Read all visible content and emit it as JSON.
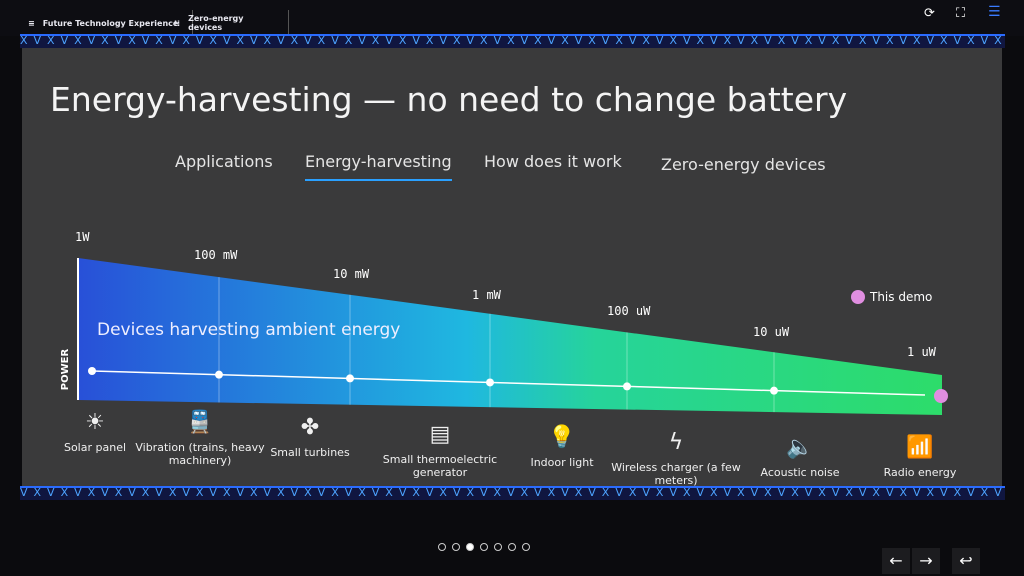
{
  "header": {
    "app_name": "Future Technology Experience",
    "section": "Zero-energy devices",
    "icons": [
      "logo-icon",
      "grid-icon",
      "refresh-icon",
      "fullscreen-icon",
      "menu-icon"
    ]
  },
  "slide": {
    "title": "Energy-harvesting — no need to change battery",
    "tabs": [
      {
        "label": "Applications"
      },
      {
        "label": "Energy-harvesting",
        "active": true
      },
      {
        "label": "How does it work"
      },
      {
        "label": "Zero-energy devices"
      }
    ],
    "chart": {
      "y_label": "POWER",
      "band_label": "Devices harvesting ambient energy",
      "power_levels": [
        "1W",
        "100 mW",
        "10 mW",
        "1 mW",
        "100 uW",
        "10 uW",
        "1 uW"
      ],
      "legend": "This demo",
      "legend_color": "#e08ee0",
      "gradient": [
        "#2850d8",
        "#1fb8e0",
        "#2ddc6a"
      ]
    },
    "sources": [
      {
        "label": "Solar panel",
        "icon": "solar-panel-icon"
      },
      {
        "label": "Vibration (trains, heavy machinery)",
        "icon": "train-icon"
      },
      {
        "label": "Small turbines",
        "icon": "turbine-icon"
      },
      {
        "label": "Small thermoelectric generator",
        "icon": "thermoelectric-icon"
      },
      {
        "label": "Indoor light",
        "icon": "lightbulb-icon"
      },
      {
        "label": "Wireless charger (a few meters)",
        "icon": "lightning-icon"
      },
      {
        "label": "Acoustic noise",
        "icon": "speaker-icon"
      },
      {
        "label": "Radio energy",
        "icon": "antenna-icon"
      }
    ]
  },
  "pagination": {
    "total": 7,
    "current": 3
  },
  "controls": {
    "prev": "←",
    "next": "→",
    "back": "↩"
  }
}
